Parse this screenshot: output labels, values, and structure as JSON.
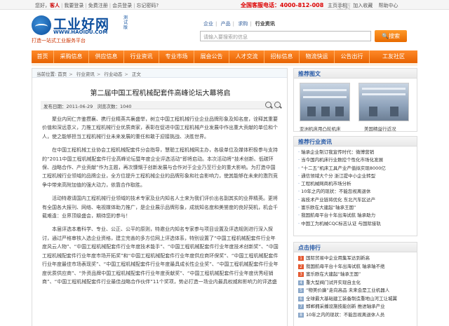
{
  "topbar": {
    "greeting": "您好，",
    "guest": "客人",
    "login": "我要登录",
    "register": "免费注册",
    "member_login": "会员登录",
    "forgot": "忘记密码?",
    "hotline": "全国客服电话：4000-812-008",
    "links": [
      "主页手机",
      "加入收藏",
      "帮助中心"
    ],
    "floater": "主页"
  },
  "logo": {
    "name": "工业好网",
    "test_badge": "测试版",
    "url": "WWW.HAOIDU.COM",
    "slogan": "打造一站式工业服务平台"
  },
  "search": {
    "tabs": [
      "企业",
      "产品",
      "求购",
      "行业资讯"
    ],
    "active_tab": "行业资讯",
    "placeholder": "请输入要搜索的信息",
    "button": "搜索"
  },
  "nav": [
    "首页",
    "采购信息",
    "供应信息",
    "行业资讯",
    "专业市场",
    "展会公告",
    "人才交流",
    "招标信息",
    "物流快运",
    "公告出行",
    "工友社区"
  ],
  "breadcrumb": {
    "prefix": "当前位置:",
    "items": [
      "首页",
      "行业资讯",
      "行业动态",
      "正文"
    ]
  },
  "article": {
    "title": "第二届中国工程机械配套件高峰论坛大幕将启",
    "date_label": "发布日期：",
    "date": "2011-06-29",
    "views_label": "浏览次数：",
    "views": "1040",
    "paragraphs": [
      "聚业内同仁齐鉴攒襄、携行业精英共襄盛举，树立中国工程机械行业企业品牌形象及知名度，诠释其重要价值和深远意义，力推工程机械行业优质商家，表彰在促进中国工程机械产业发展中作出重大贡献的单位和个人，使之能够担当工程机械行业未来发展的重任和敢于迎接挑战、决胜世界。",
      "在中国工程机械工业协会工程机械配套件分会指导，慧聪工程机械网主办，各级单位及媒体积极参与支持的“2011中国工程机械配套件行业高峰论坛暨年度企业评选活动”即将启动。本次活动将“技术创新、低碳环保、战略合作、产业贡献”作为主题，再次慷慨于创新发展与合作对于企业乃至行业的重大影响。为打造中国工程机械行业领域的品牌企业，全方位提升工程机械企业的品牌形象和社会影响力，使其能够在未来的激烈竞争中带来高附加值的强大动力，依靠合作取胜。",
      "活动特邀请国内工程机械行业领域的技术专家及业内知名人士来为我们评价出名副其实的业界精英。更将有全国各大报刊、网络、电视媒体助力推广，是企业展示品牌形象，成就知名度和美誉度的良好契机，机会千载难逢：业界顶级盛会，期待您的参与！",
      "本届评选本着科学、专业、公正、公平的原则，特邀业内知名专家参与项目设置及评选规则进行深入探讨，通过严格审核入选企业资格，建立完善的多方位网上评选体系，特别设置了“中国工程机械配套件行业年度风云人物”、“中国工程机械配套件行业年度技术能手”、“中国工程机械配套件行业年度技术创新奖”、“中国工程机械配套件行业年度市场开拓奖”和“中国工程机械配套件行业年度供应商环保奖”、“中国工程机械配套件行业年度最佳市场表现奖”、“中国工程机械配套件行业年度最具成长性企业奖”、“中国工程机械配套件行业年度优质供应商”、“外资品牌中国工程机械配套件行业年度贡献奖”、“中国工程机械配套件行业年度优秀经销商”、“中国工程机械配套件行业最佳战略合作伙伴”11个奖项，势必打造一场业内最具权威和影响力的评选盛"
    ]
  },
  "side_pics": {
    "title": "推荐图文",
    "items": [
      "亚洲机床用凸轮机床",
      "美国精益行近况"
    ]
  },
  "side_news": {
    "title": "推荐行业资讯",
    "items": [
      "轴承企业制订我宣传时代：微博营销",
      "当今国内机床行业数控个性化市场化发展",
      "“十二五”机床工具产业产值拟实现8000亿",
      "通信领域大个分 浙江提中小企业转型",
      "工程机械网商机市场分析",
      "10年之内的现状：不能忽视离退休",
      "高技术产业链将优化 东北汽车区达产",
      "富乐欧在大建起“轴承王国”",
      "我国航母平台十年出海试航 轴承助力",
      "中国工为机械CQC标志认证 与国际接轨"
    ]
  },
  "side_rank": {
    "title": "点击排行",
    "items": [
      "国际贸易中企业用集军达到新高",
      "我国航母平台十年出海试航 轴承轴不绝",
      "富乐欧在大建起“轴承王国”",
      "重大型阀门试开实现自主化",
      "“物美价廉”走向高品 未来会是工业机器人",
      "全球最大基础建工装备制造重地山河工让城翼",
      "邯郸拥采播设施技能创新 推进轴承产业",
      "10年之内的现状：不能忽视离退休人员"
    ]
  }
}
